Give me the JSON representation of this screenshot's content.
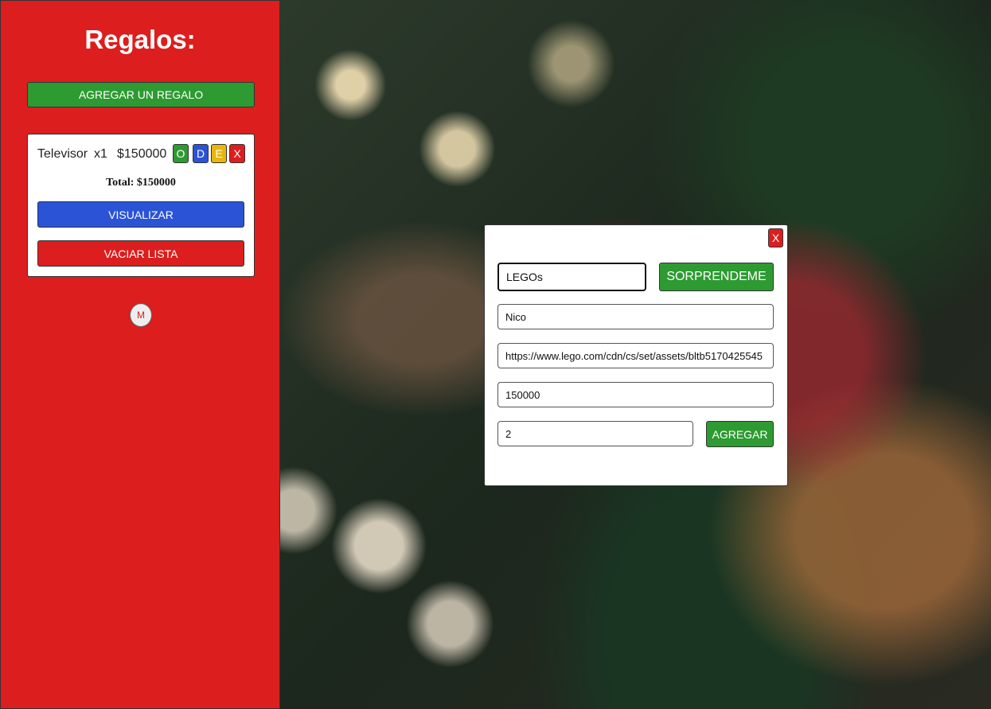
{
  "sidebar": {
    "title": "Regalos:",
    "add_button": "AGREGAR UN REGALO",
    "items": [
      {
        "name": "Televisor",
        "quantity": "x1",
        "price": "$150000",
        "actions": {
          "o": "O",
          "d": "D",
          "e": "E",
          "x": "X"
        }
      }
    ],
    "total": "Total: $150000",
    "visualize_button": "VISUALIZAR",
    "clear_button": "VACIAR LISTA",
    "m_button": "M"
  },
  "modal": {
    "close": "X",
    "gift_name_value": "LEGOs",
    "surprise_button": "SORPRENDEME",
    "recipient_value": "Nico",
    "image_url_value": "https://www.lego.com/cdn/cs/set/assets/bltb5170425545",
    "price_value": "150000",
    "quantity_value": "2",
    "add_button": "AGREGAR"
  },
  "colors": {
    "sidebar_red": "#dc1e1e",
    "green": "#2e9a32",
    "blue": "#2a53d6",
    "yellow": "#e8b60e"
  }
}
